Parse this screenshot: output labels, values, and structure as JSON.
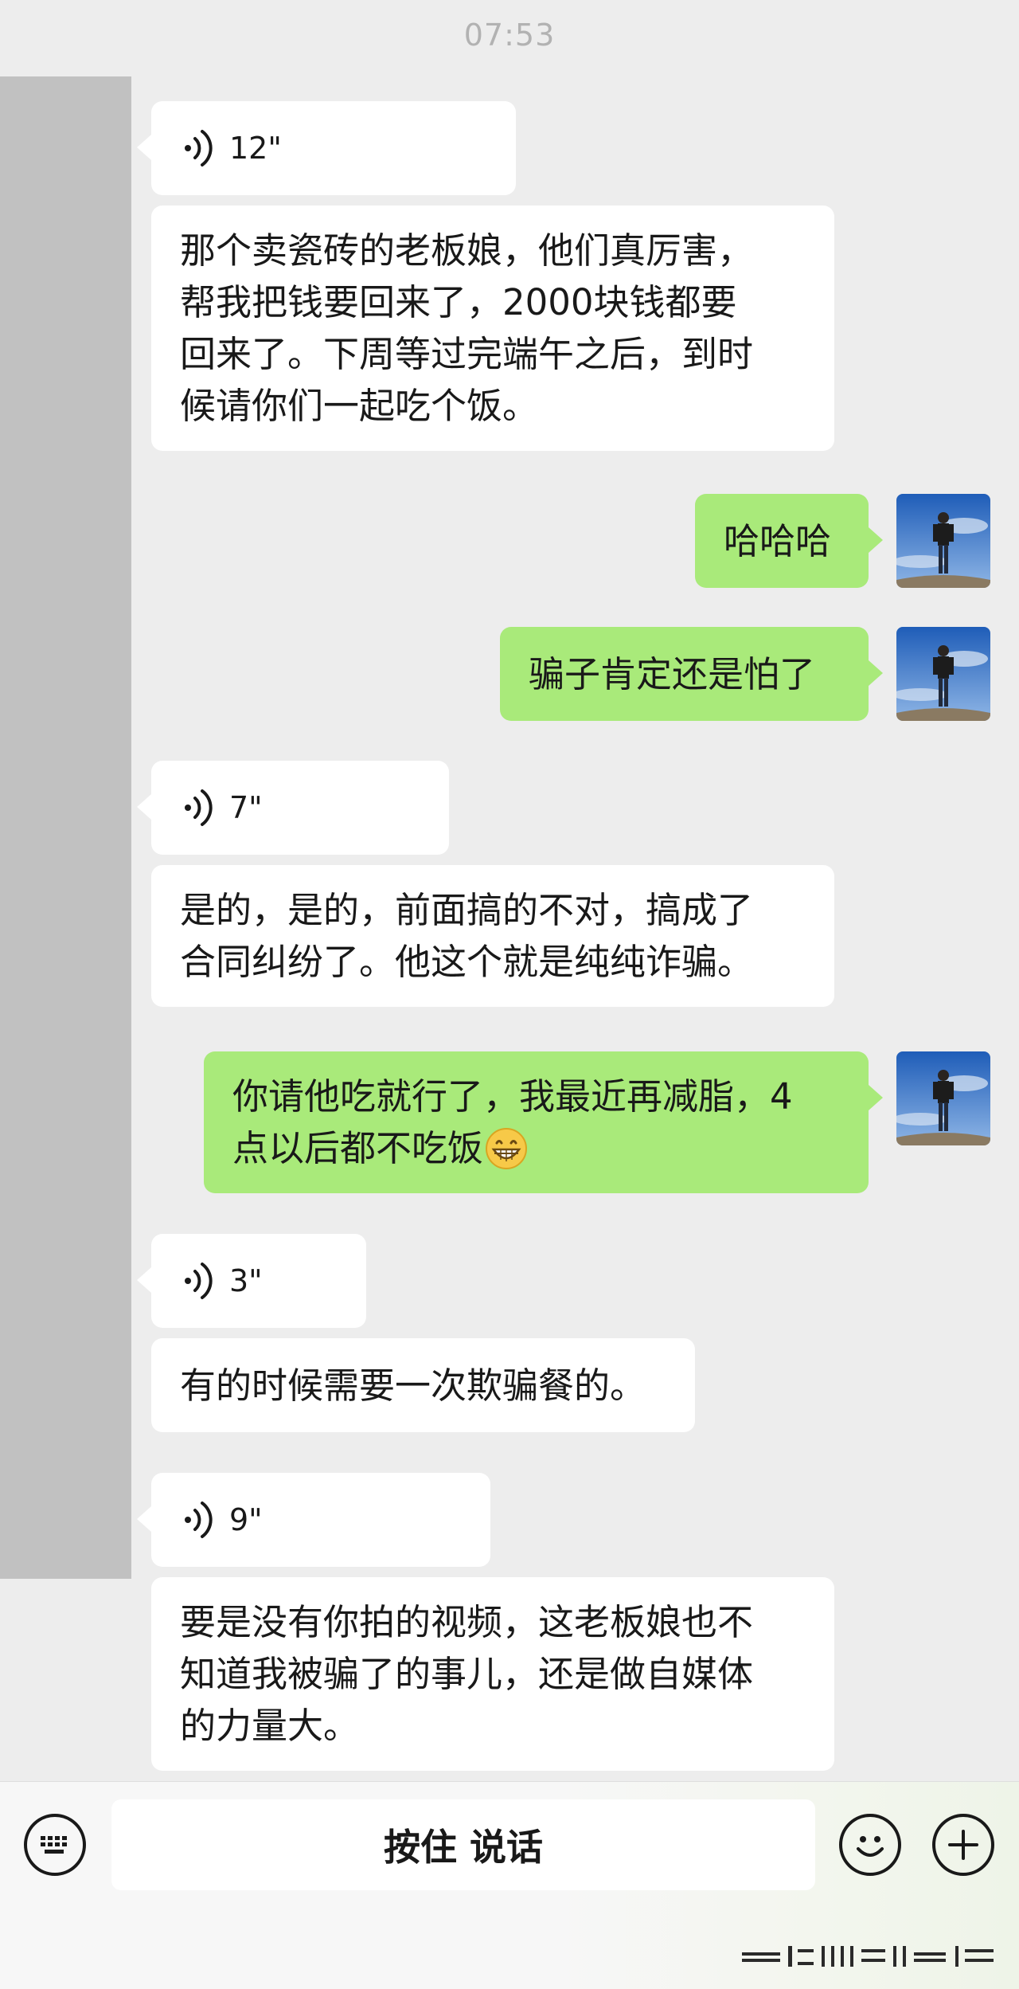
{
  "timestamp": "07:53",
  "messages": [
    {
      "side": "in",
      "type": "voice",
      "duration": "12\""
    },
    {
      "side": "in",
      "type": "text",
      "lines": [
        "那个卖瓷砖的老板娘，他们真厉害，",
        "帮我把钱要回来了，2000块钱都要",
        "回来了。下周等过完端午之后，到时",
        "候请你们一起吃个饭。"
      ]
    },
    {
      "side": "out",
      "type": "text",
      "lines": [
        "哈哈哈"
      ]
    },
    {
      "side": "out",
      "type": "text",
      "lines": [
        "骗子肯定还是怕了"
      ]
    },
    {
      "side": "in",
      "type": "voice",
      "duration": "7\""
    },
    {
      "side": "in",
      "type": "text",
      "lines": [
        "是的，是的，前面搞的不对，搞成了",
        "合同纠纷了。他这个就是纯纯诈骗。"
      ]
    },
    {
      "side": "out",
      "type": "text",
      "lines": [
        "你请他吃就行了，我最近再减脂，4",
        "点以后都不吃饭"
      ],
      "emoji": "grinning-face"
    },
    {
      "side": "in",
      "type": "voice",
      "duration": "3\""
    },
    {
      "side": "in",
      "type": "text",
      "lines": [
        "有的时候需要一次欺骗餐的。"
      ]
    },
    {
      "side": "in",
      "type": "voice",
      "duration": "9\""
    },
    {
      "side": "in",
      "type": "text",
      "lines": [
        "要是没有你拍的视频，这老板娘也不",
        "知道我被骗了的事儿，还是做自媒体",
        "的力量大。"
      ]
    }
  ],
  "input_bar": {
    "hold_to_talk_label": "按住 说话",
    "left_icon": "keyboard-icon",
    "right_icons": [
      "emoji-icon",
      "plus-icon"
    ]
  },
  "colors": {
    "background": "#ededed",
    "incoming_bubble": "#ffffff",
    "outgoing_bubble": "#a9ea7a",
    "timestamp": "#b2b2b2"
  }
}
